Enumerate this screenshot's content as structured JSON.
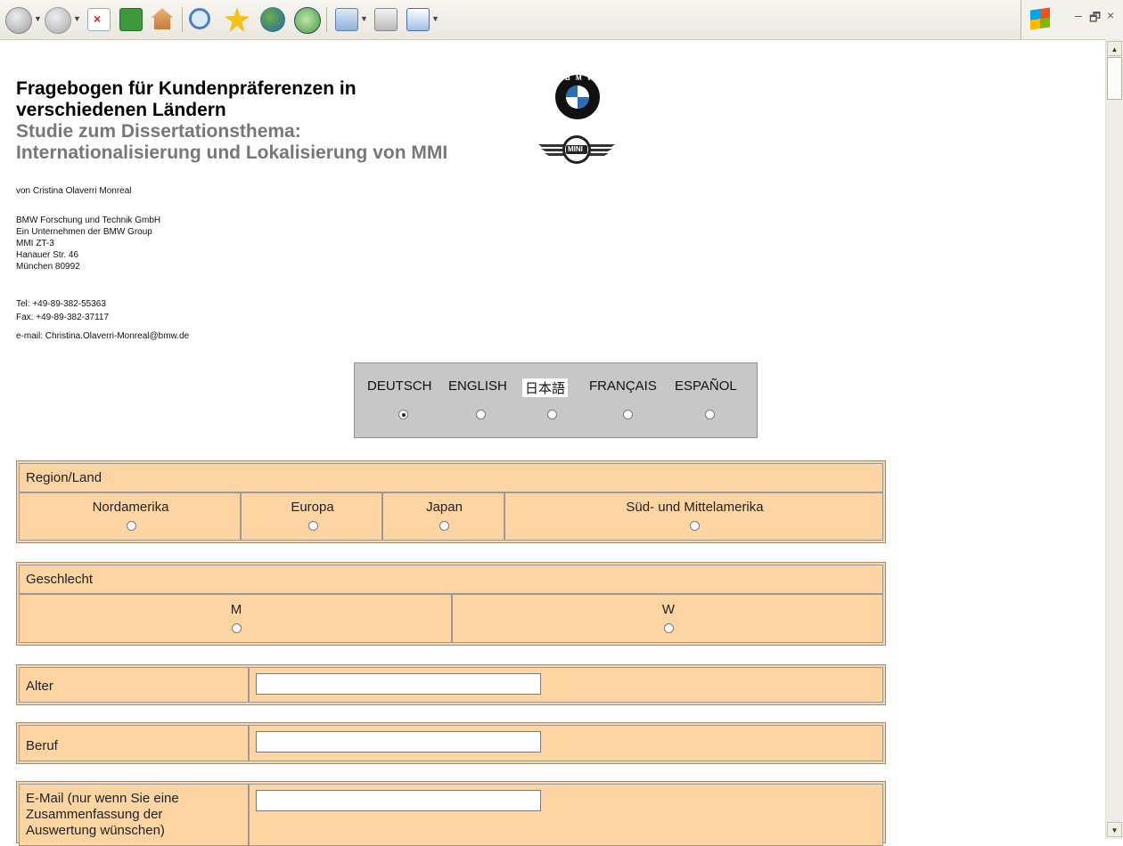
{
  "browser": {
    "toolbar_buttons": [
      "back-icon",
      "forward-icon",
      "stop-icon",
      "refresh-icon",
      "home-icon",
      "search-icon",
      "favorites-icon",
      "media-icon",
      "history-icon",
      "mail-icon",
      "print-icon",
      "edit-icon"
    ],
    "window_controls": {
      "minimize": "–",
      "restore": "🗗",
      "close": "×"
    }
  },
  "header": {
    "title_line1": "Fragebogen für Kundenpräferenzen in",
    "title_line2": "verschiedenen Ländern",
    "subtitle_line1": "Studie zum Dissertationsthema:",
    "subtitle_line2": "Internationalisierung und Lokalisierung von MMI",
    "author": "von Cristina Olaverri Monreal",
    "address": [
      "BMW Forschung und Technik GmbH",
      "Ein Unternehmen der BMW Group",
      "MMI ZT-3",
      "Hanauer Str. 46",
      "München 80992"
    ],
    "tel": "Tel: +49-89-382-55363",
    "fax": "Fax: +49-89-382-37117",
    "email": "e-mail: Christina.Olaverri-Monreal@bmw.de",
    "mini_logo_text": "MINI",
    "bmw_logo_text": "B M W"
  },
  "language": {
    "options": [
      "DEUTSCH",
      "ENGLISH",
      "日本語",
      "FRANÇAIS",
      "ESPAÑOL"
    ],
    "selected": "DEUTSCH"
  },
  "form": {
    "region": {
      "label": "Region/Land",
      "options": [
        "Nordamerika",
        "Europa",
        "Japan",
        "Süd- und Mittelamerika"
      ]
    },
    "gender": {
      "label": "Geschlecht",
      "options": [
        "M",
        "W"
      ]
    },
    "age": {
      "label": "Alter",
      "value": ""
    },
    "job": {
      "label": "Beruf",
      "value": ""
    },
    "email": {
      "label_lines": [
        "E-Mail (nur wenn Sie eine",
        "Zusammenfassung der",
        "Auswertung wünschen)"
      ],
      "value": ""
    }
  },
  "colors": {
    "form_bg": "#fcd5a3",
    "lang_box_bg": "#c7c7c7",
    "subtitle": "#777777"
  }
}
